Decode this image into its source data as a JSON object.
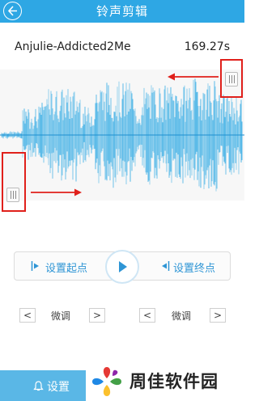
{
  "header": {
    "title": "铃声剪辑"
  },
  "track": {
    "name": "Anjulie-Addicted2Me",
    "duration": "169.27s"
  },
  "controls": {
    "set_start_label": "设置起点",
    "set_end_label": "设置终点"
  },
  "fine_tune": {
    "left": {
      "prev": "<",
      "label": "微调",
      "next": ">"
    },
    "right": {
      "prev": "<",
      "label": "微调",
      "next": ">"
    }
  },
  "bottom": {
    "settings_label": "设置"
  },
  "watermark": {
    "text": "周佳软件园"
  },
  "colors": {
    "accent": "#2ea7e4",
    "waveform": "#3fb0e6",
    "highlight": "#e0201b"
  }
}
